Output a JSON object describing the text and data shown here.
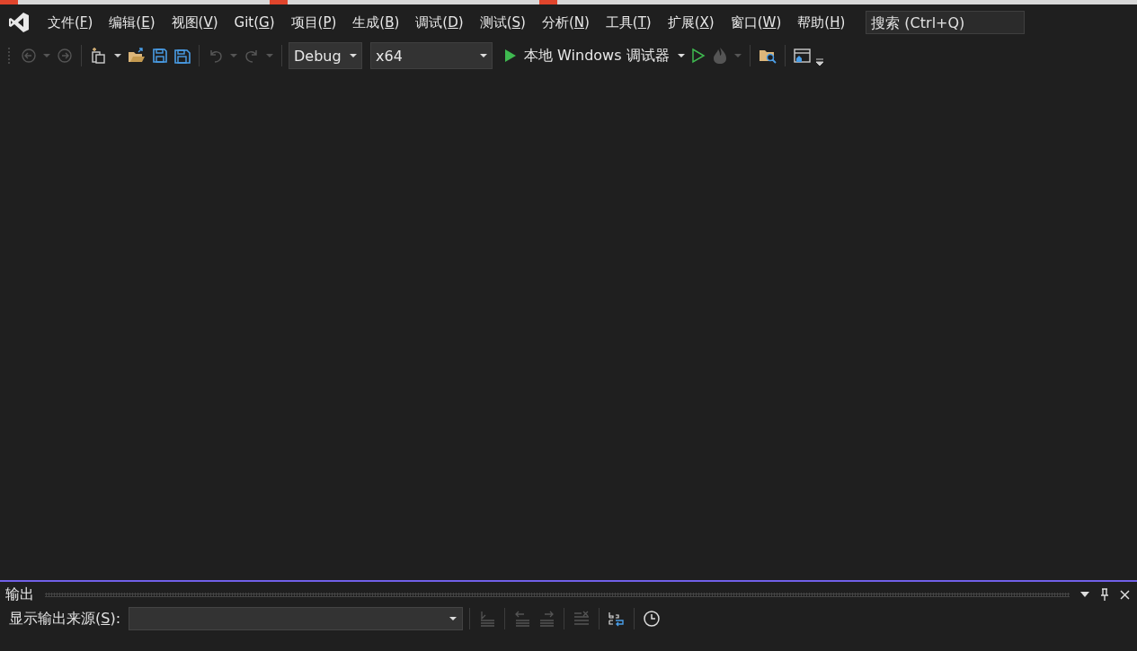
{
  "menu": [
    {
      "text": "文件(",
      "mnemonic": "F",
      "close": ")"
    },
    {
      "text": "编辑(",
      "mnemonic": "E",
      "close": ")"
    },
    {
      "text": "视图(",
      "mnemonic": "V",
      "close": ")"
    },
    {
      "text": "Git(",
      "mnemonic": "G",
      "close": ")"
    },
    {
      "text": "项目(",
      "mnemonic": "P",
      "close": ")"
    },
    {
      "text": "生成(",
      "mnemonic": "B",
      "close": ")"
    },
    {
      "text": "调试(",
      "mnemonic": "D",
      "close": ")"
    },
    {
      "text": "测试(",
      "mnemonic": "S",
      "close": ")"
    },
    {
      "text": "分析(",
      "mnemonic": "N",
      "close": ")"
    },
    {
      "text": "工具(",
      "mnemonic": "T",
      "close": ")"
    },
    {
      "text": "扩展(",
      "mnemonic": "X",
      "close": ")"
    },
    {
      "text": "窗口(",
      "mnemonic": "W",
      "close": ")"
    },
    {
      "text": "帮助(",
      "mnemonic": "H",
      "close": ")"
    }
  ],
  "search": {
    "placeholder": "搜索 (Ctrl+Q)"
  },
  "toolbar": {
    "back": {
      "disabled": true
    },
    "forward": {
      "disabled": true
    },
    "undo": {
      "disabled": true
    },
    "redo": {
      "disabled": true
    },
    "hot_reload": {
      "disabled": true
    },
    "configuration": "Debug",
    "platform": "x64",
    "start": "本地 Windows 调试器"
  },
  "output": {
    "title": "输出",
    "source_label": "显示输出来源(",
    "source_mnemonic": "S",
    "source_close": "):",
    "tools": [
      {
        "disabled": true
      },
      {
        "disabled": true
      },
      {
        "disabled": true
      },
      {
        "disabled": true
      },
      {
        "disabled": false
      },
      {
        "disabled": false
      }
    ]
  }
}
